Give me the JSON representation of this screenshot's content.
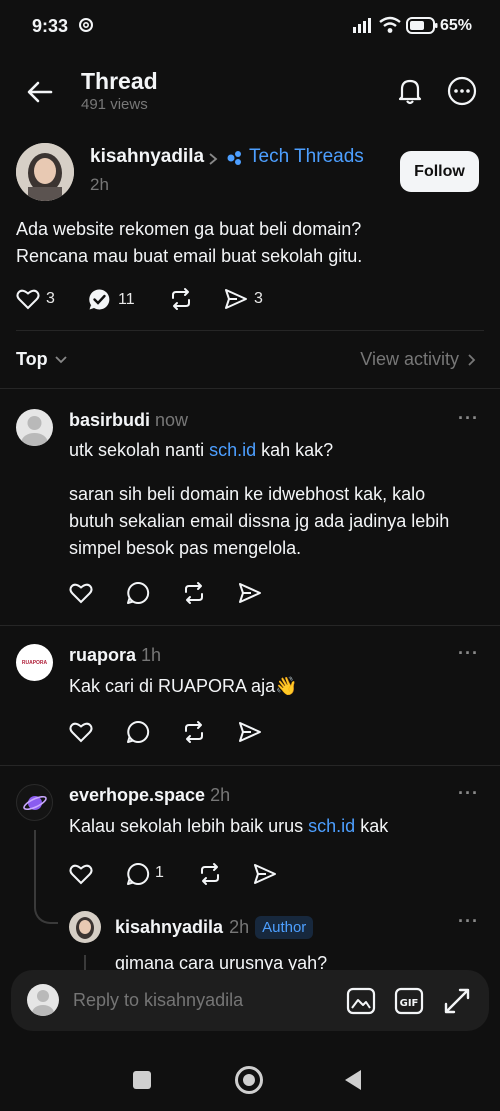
{
  "status_bar": {
    "time": "9:33",
    "threads_glyph": "@",
    "battery": "65%"
  },
  "header": {
    "title": "Thread",
    "views": "491 views"
  },
  "post": {
    "username": "kisahnyadila",
    "community": "Tech Threads",
    "time": "2h",
    "follow_label": "Follow",
    "text_line1": "Ada website rekomen ga buat beli domain?",
    "text_line2": "Rencana mau buat email buat sekolah gitu.",
    "likes": "3",
    "replies": "11",
    "shares": "3"
  },
  "sort": {
    "label": "Top",
    "activity": "View activity"
  },
  "replies": [
    {
      "username": "basirbudi",
      "time": "now",
      "line1_pre": "utk sekolah nanti ",
      "line1_link": "sch.id",
      "line1_post": " kah kak?",
      "para1": "saran sih beli domain ke idwebhost kak, kalo",
      "para2": "butuh sekalian email dissna jg ada jadinya lebih",
      "para3": "simpel besok pas mengelola."
    },
    {
      "username": "ruapora",
      "time": "1h",
      "text": "Kak cari di RUAPORA aja👋",
      "avatar_text": "RUAPORA"
    },
    {
      "username": "everhope.space",
      "time": "2h",
      "text_pre": "Kalau sekolah lebih baik urus ",
      "text_link": "sch.id",
      "text_post": " kak",
      "reply_count": "1"
    },
    {
      "username": "kisahnyadila",
      "time": "2h",
      "badge": "Author",
      "text": "gimana cara urusnya yah?"
    }
  ],
  "composer": {
    "placeholder": "Reply to kisahnyadila"
  },
  "colors": {
    "accent": "#4d9fff",
    "background": "#101010",
    "composer_bg": "#1e1e1e"
  }
}
